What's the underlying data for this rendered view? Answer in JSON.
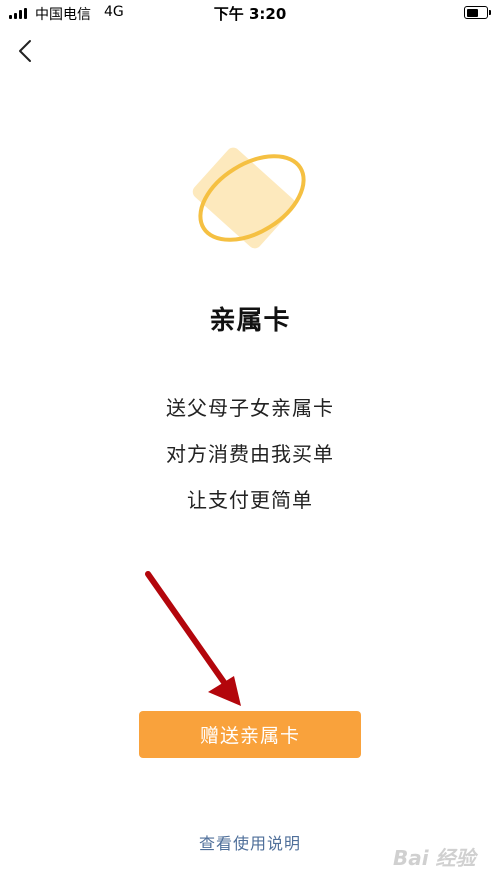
{
  "status_bar": {
    "carrier": "中国电信",
    "network": "4G",
    "time": "下午 3:20"
  },
  "nav": {
    "back_icon": "chevron-left-icon"
  },
  "hero": {
    "icon": "family-card-illustration",
    "card_color": "#fde9bd",
    "ring_color": "#f5c042"
  },
  "main": {
    "title": "亲属卡",
    "description": [
      "送父母子女亲属卡",
      "对方消费由我买单",
      "让支付更简单"
    ]
  },
  "actions": {
    "primary_label": "赠送亲属卡",
    "primary_color": "#f9a23c",
    "help_link": "查看使用说明",
    "link_color": "#4f6f9a"
  },
  "annotation": {
    "arrow_color": "#b3060c"
  },
  "watermark": {
    "text": "Bai 经验"
  }
}
